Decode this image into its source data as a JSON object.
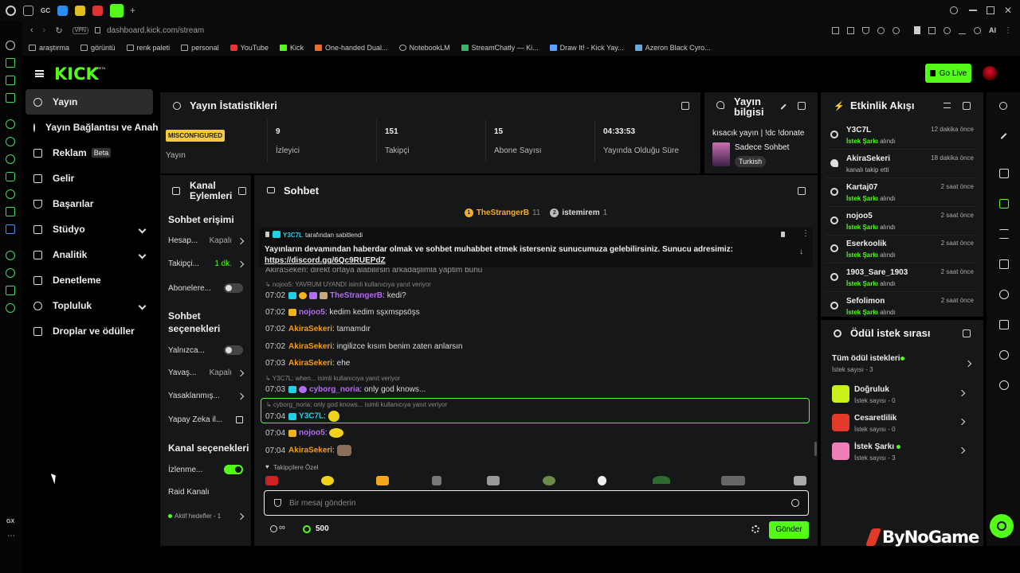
{
  "browser": {
    "url": "dashboard.kick.com/stream",
    "vpn": "VPN",
    "ai": "AI",
    "gx": "GX",
    "tab_gc": "GC",
    "bookmarks": [
      "araştırma",
      "görüntü",
      "renk paleti",
      "personal",
      "YouTube",
      "Kick",
      "One-handed Dual...",
      "NotebookLM",
      "StreamChatly — Ki...",
      "Draw It! - Kick Yay...",
      "Azeron Black Cyro..."
    ]
  },
  "header": {
    "logo": "KICK",
    "logo_sup": "BETA",
    "go_live": "Go Live"
  },
  "sidebar": {
    "items": [
      {
        "label": "Yayın"
      },
      {
        "label": "Yayın Bağlantısı ve Anahtar"
      },
      {
        "label": "Reklam",
        "badge": "Beta"
      },
      {
        "label": "Gelir"
      },
      {
        "label": "Başarılar"
      },
      {
        "label": "Stüdyo"
      },
      {
        "label": "Analitik"
      },
      {
        "label": "Denetleme"
      },
      {
        "label": "Topluluk"
      },
      {
        "label": "Droplar ve ödüller"
      }
    ]
  },
  "stats": {
    "title": "Yayın İstatistikleri",
    "status": "MISCONFIGURED",
    "status_label": "Yayın",
    "cells": [
      {
        "value": "9",
        "label": "İzleyici"
      },
      {
        "value": "151",
        "label": "Takipçi"
      },
      {
        "value": "15",
        "label": "Abone Sayısı"
      },
      {
        "value": "04:33:53",
        "label": "Yayında Olduğu Süre"
      }
    ]
  },
  "stream_info": {
    "title_line1": "Yayın",
    "title_line2": "bilgisi",
    "stream_title": "kısacık yayın | !dc !donate",
    "category": "Sadece Sohbet",
    "tag": "Turkish"
  },
  "channel_actions": {
    "title_line1": "Kanal",
    "title_line2": "Eylemleri",
    "chat_access": "Sohbet erişimi",
    "rows1": [
      {
        "label": "Hesap...",
        "value": "Kapalı"
      },
      {
        "label": "Takipçi...",
        "value": "1 dk."
      }
    ],
    "subs": "Abonelere...",
    "chat_options_line1": "Sohbet",
    "chat_options_line2": "seçenekleri",
    "only": "Yalnızca...",
    "slow": "Yavaş...",
    "slow_value": "Kapalı",
    "banned": "Yasaklanmış...",
    "ai": "Yapay Zeka il...",
    "channel_options": "Kanal seçenekleri",
    "watch": "İzlenme...",
    "raid": "Raid Kanalı",
    "targets": "Aktif hedefler - 1"
  },
  "chat": {
    "title": "Sohbet",
    "top": [
      {
        "rank": "1",
        "name": "TheStrangerB",
        "count": "11"
      },
      {
        "rank": "2",
        "name": "istemirem",
        "count": "1"
      }
    ],
    "pinned_by_user": "Y3C7L",
    "pinned_by_suffix": "tarafından sabitlendi",
    "pinned_text": "Yayınların devamından haberdar olmak ve sohbet muhabbet etmek isterseniz sunucumuza gelebilirsiniz. Sunucu adresimiz:",
    "pinned_link": "https://discord.gg/6Qc9RUEPdZ",
    "hidden_line": "AkiraSekeri: direkt ortaya alabilirsin arkadaşlimla yaptim bunu",
    "messages": [
      {
        "reply": "nojoo5: YAVRUM UYANDI isimli kullanıcıya yanıt veriyor"
      },
      {
        "time": "07:02",
        "user": "TheStrangerB",
        "text": "kedi?"
      },
      {
        "time": "07:02",
        "user": "nojoo5",
        "text": "kedim kedim sşxmspsöşs"
      },
      {
        "time": "07:02",
        "user": "AkiraSekeri",
        "text": "tamamdır"
      },
      {
        "time": "07:02",
        "user": "AkiraSekeri",
        "text": "ingilizce kısım benim zaten anlarsın"
      },
      {
        "time": "07:03",
        "user": "AkiraSekeri",
        "text": "ehe"
      },
      {
        "reply": "Y3C7L: when... isimli kullanıcıya yanıt veriyor"
      },
      {
        "time": "07:03",
        "user": "cyborg_noria",
        "text": "only god knows..."
      },
      {
        "reply": "cyborg_noria: only god knows... isimli kullanıcıya yanıt veriyor"
      },
      {
        "time": "07:04",
        "user": "Y3C7L",
        "text": ""
      },
      {
        "time": "07:04",
        "user": "nojoo5",
        "text": ""
      },
      {
        "time": "07:04",
        "user": "AkiraSekeri",
        "text": ""
      }
    ],
    "followers_only": "Takipçilere Özel",
    "input_placeholder": "Bir mesaj gönderin",
    "points": "500",
    "send": "Gönder"
  },
  "activity": {
    "title": "Etkinlik Akışı",
    "events": [
      {
        "name": "Y3C7L",
        "desc_b": "İstek Şarkı",
        "desc": "alındı",
        "time": "12 dakika önce"
      },
      {
        "name": "AkiraSekeri",
        "desc_b": "",
        "desc": "kanalı takip etti",
        "time": "18 dakika önce"
      },
      {
        "name": "Kartaj07",
        "desc_b": "İstek Şarkı",
        "desc": "alındı",
        "time": "2 saat önce"
      },
      {
        "name": "nojoo5",
        "desc_b": "İstek Şarkı",
        "desc": "alındı",
        "time": "2 saat önce"
      },
      {
        "name": "Eserkoolik",
        "desc_b": "İstek Şarkı",
        "desc": "alındı",
        "time": "2 saat önce"
      },
      {
        "name": "1903_Sare_1903",
        "desc_b": "İstek Şarkı",
        "desc": "alındı",
        "time": "2 saat önce"
      },
      {
        "name": "Sefolimon",
        "desc_b": "İstek Şarkı",
        "desc": "alındı",
        "time": "2 saat önce"
      }
    ]
  },
  "rewards": {
    "title": "Ödül istek sırası",
    "all": "Tüm ödül istekleri",
    "all_count": "İstek sayısı - 3",
    "items": [
      {
        "name": "Doğruluk",
        "count": "İstek sayısı - 0",
        "color": "#c9f01b"
      },
      {
        "name": "Cesaretlilik",
        "count": "İstek sayısı - 0",
        "color": "#e23b2a"
      },
      {
        "name": "İstek Şarkı",
        "count": "İstek sayısı - 3",
        "color": "#ef7fb8"
      }
    ]
  },
  "watermark": "ByNoGame",
  "colors": {
    "accent": "#53fc18",
    "panel": "#161718",
    "user_orange": "#f39c1c",
    "user_purple": "#b26cf0",
    "user_cyan": "#1fd1e6"
  }
}
